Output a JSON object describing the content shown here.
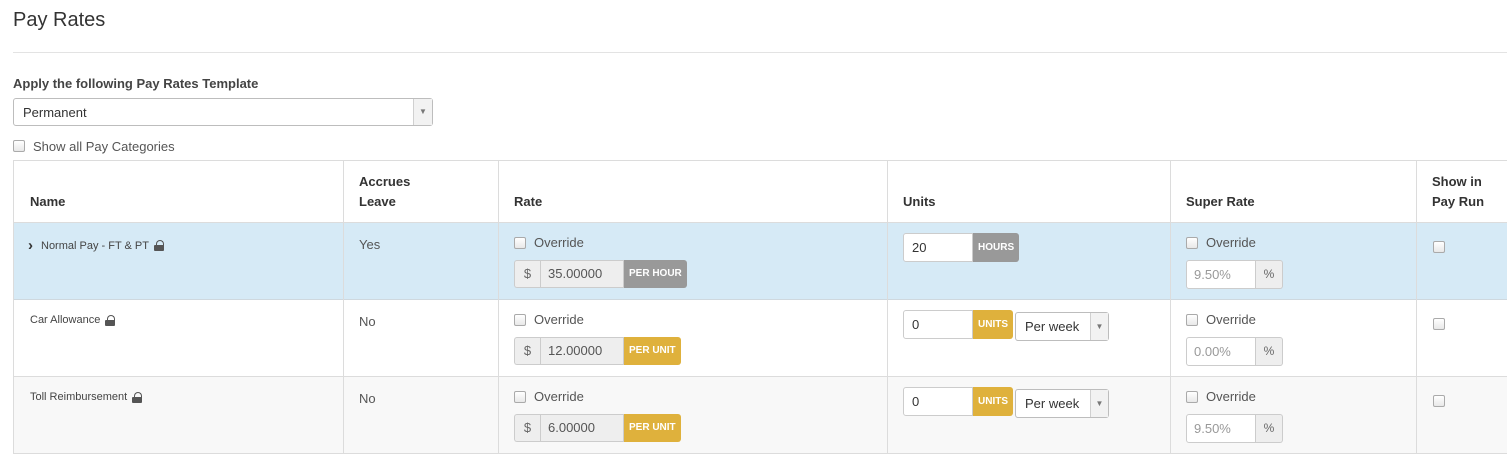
{
  "page": {
    "title": "Pay Rates"
  },
  "template": {
    "label": "Apply the following Pay Rates Template",
    "selected": "Permanent"
  },
  "show_all": {
    "label": "Show all Pay Categories",
    "checked": false
  },
  "table": {
    "headers": {
      "name": "Name",
      "accrues_1": "Accrues",
      "accrues_2": "Leave",
      "rate": "Rate",
      "units": "Units",
      "super_rate": "Super Rate",
      "show_1": "Show in",
      "show_2": "Pay Run"
    },
    "rows": [
      {
        "name": "Normal Pay - FT & PT",
        "expandable": true,
        "locked": true,
        "accrues_leave": "Yes",
        "rate_override_label": "Override",
        "currency": "$",
        "rate": "35.00000",
        "rate_unit": "PER HOUR",
        "units": "20",
        "units_type": "HOURS",
        "period": "",
        "super_override_label": "Override",
        "super_rate": "9.50%",
        "percent_sign": "%",
        "highlighted": true
      },
      {
        "name": "Car Allowance",
        "expandable": false,
        "locked": true,
        "accrues_leave": "No",
        "rate_override_label": "Override",
        "currency": "$",
        "rate": "12.00000",
        "rate_unit": "PER UNIT",
        "units": "0",
        "units_type": "UNITS",
        "period": "Per week",
        "super_override_label": "Override",
        "super_rate": "0.00%",
        "percent_sign": "%",
        "highlighted": false
      },
      {
        "name": "Toll Reimbursement",
        "expandable": false,
        "locked": true,
        "accrues_leave": "No",
        "rate_override_label": "Override",
        "currency": "$",
        "rate": "6.00000",
        "rate_unit": "PER UNIT",
        "units": "0",
        "units_type": "UNITS",
        "period": "Per week",
        "super_override_label": "Override",
        "super_rate": "9.50%",
        "percent_sign": "%",
        "highlighted": false
      }
    ]
  },
  "colors": {
    "highlight_row": "#d6eaf6",
    "badge_grey": "#999999",
    "badge_gold": "#dfb13c"
  },
  "icons": {
    "expand": "chevron-right-icon",
    "lock": "lock-icon",
    "dropdown": "triangle-down-icon"
  }
}
